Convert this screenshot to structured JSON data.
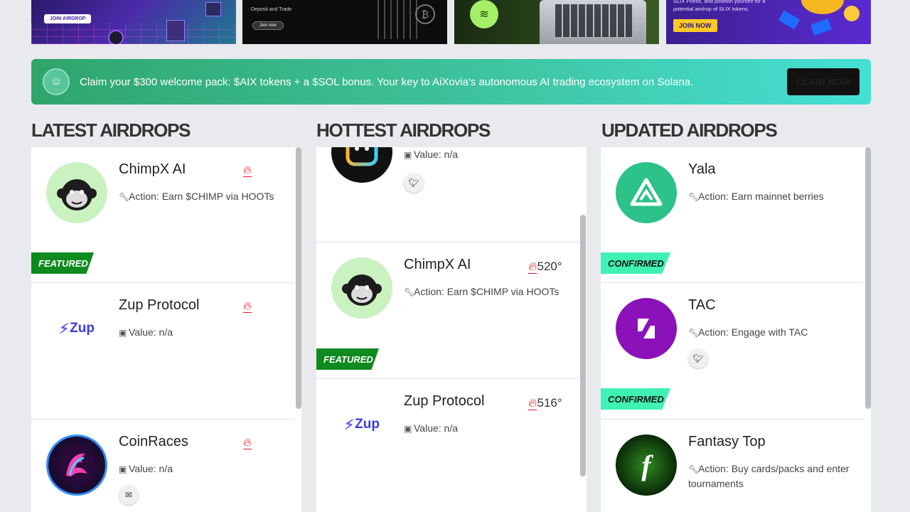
{
  "banners": [
    {
      "button": "JOIN AIRDROP"
    },
    {
      "text": "Deposit and Trade",
      "button": "Join now"
    },
    {},
    {
      "text": "SLIX Points, and position yourself for a potential airdrop of SLIX tokens.",
      "button": "JOIN NOW"
    }
  ],
  "promo": {
    "message": "Claim your $300 welcome pack: $AIX tokens + a $SOL bonus. Your key to AiXovia's autonomous AI trading ecosystem on Solana.",
    "button": "CLAIM NOW"
  },
  "columns": {
    "latest": {
      "title": "LATEST AIRDROPS",
      "cards": [
        {
          "name": "ChimpX AI",
          "meta_icon": "wrench-icon",
          "meta": "Action: Earn $CHIMP via HOOTs",
          "tag": "FEATURED"
        },
        {
          "name": "Zup Protocol",
          "logo_text": "Zup",
          "meta_icon": "money-icon",
          "meta": "Value: n/a"
        },
        {
          "name": "CoinRaces",
          "meta_icon": "money-icon",
          "meta": "Value: n/a",
          "social": "envelope-icon"
        }
      ]
    },
    "hottest": {
      "title": "HOTTEST AIRDROPS",
      "cards": [
        {
          "meta_icon": "money-icon",
          "meta": "Value: n/a",
          "social": "twitter-icon"
        },
        {
          "name": "ChimpX AI",
          "temp": "520°",
          "meta_icon": "wrench-icon",
          "meta": "Action: Earn $CHIMP via HOOTs",
          "tag": "FEATURED"
        },
        {
          "name": "Zup Protocol",
          "logo_text": "Zup",
          "temp": "516°",
          "meta_icon": "money-icon",
          "meta": "Value: n/a"
        }
      ]
    },
    "updated": {
      "title": "UPDATED AIRDROPS",
      "cards": [
        {
          "name": "Yala",
          "meta_icon": "wrench-icon",
          "meta": "Action: Earn mainnet berries",
          "tag": "CONFIRMED"
        },
        {
          "name": "TAC",
          "meta_icon": "wrench-icon",
          "meta": "Action: Engage with TAC",
          "social": "twitter-icon",
          "tag": "CONFIRMED"
        },
        {
          "name": "Fantasy Top",
          "meta_icon": "wrench-icon",
          "meta": "Action: Buy cards/packs and enter tournaments"
        }
      ]
    }
  },
  "colors": {
    "featured": "#0f8a1e",
    "confirmed": "#3ff2b4",
    "fire": "#e0181e",
    "promo_start": "#2fa56c",
    "promo_end": "#45e0d6"
  }
}
